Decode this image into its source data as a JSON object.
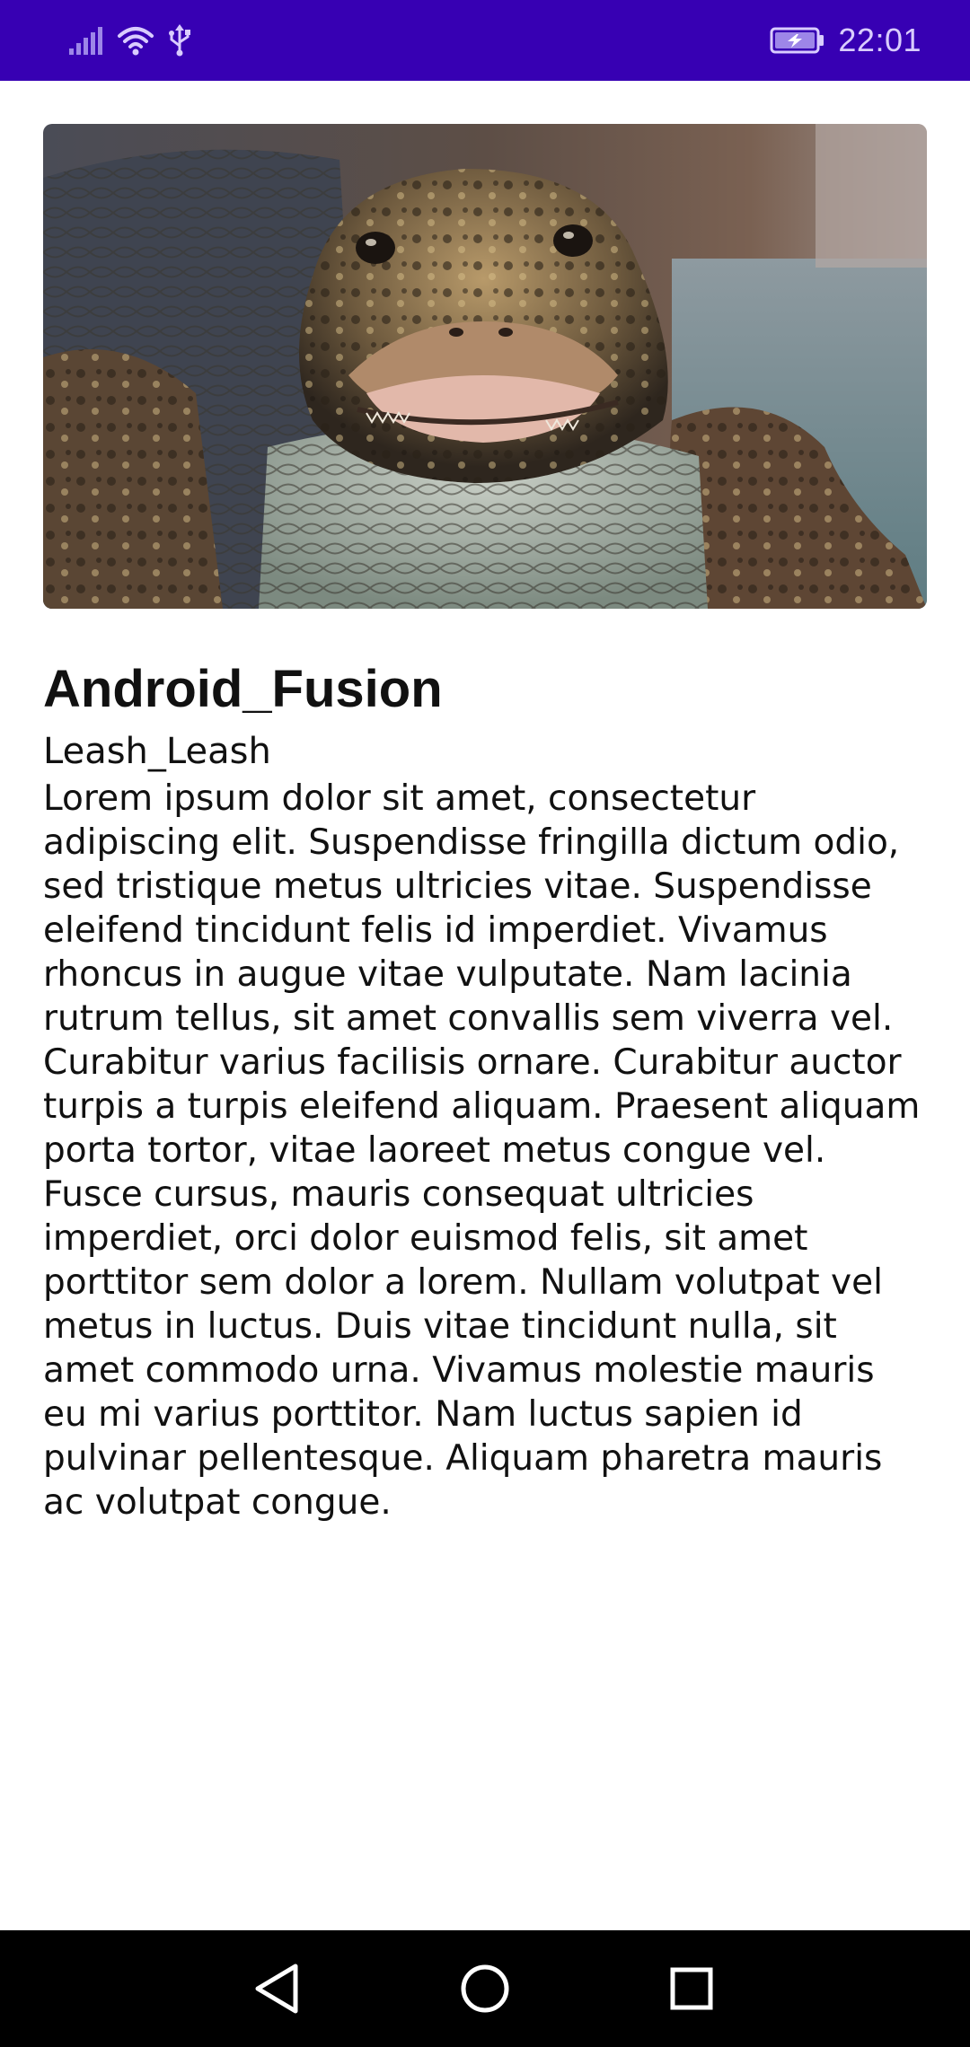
{
  "status_bar": {
    "time": "22:01",
    "icons": [
      "signal-icon",
      "wifi-icon",
      "usb-icon",
      "battery-charging-icon"
    ]
  },
  "article": {
    "image_alt": "Close-up photo of a crocodilian facing the camera",
    "title": "Android_Fusion",
    "subtitle": "Leash_Leash",
    "body": "Lorem ipsum dolor sit amet, consectetur adipiscing elit. Suspendisse fringilla dictum odio, sed tristique metus ultricies vitae. Suspendisse eleifend tincidunt felis id imperdiet. Vivamus rhoncus in augue vitae vulputate. Nam lacinia rutrum tellus, sit amet convallis sem viverra vel. Curabitur varius facilisis ornare. Curabitur auctor turpis a turpis eleifend aliquam. Praesent aliquam porta tortor, vitae laoreet metus congue vel. Fusce cursus, mauris consequat ultricies imperdiet, orci dolor euismod felis, sit amet porttitor sem dolor a lorem. Nullam volutpat vel metus in luctus. Duis vitae tincidunt nulla, sit amet commodo urna. Vivamus molestie mauris eu mi varius porttitor. Nam luctus sapien id pulvinar pellentesque. Aliquam pharetra mauris ac volutpat congue."
  },
  "nav_bar": {
    "buttons": [
      "back-icon",
      "home-icon",
      "recents-icon"
    ]
  },
  "colors": {
    "status_bar": "#3700b3",
    "nav_bar": "#000000",
    "text": "#111111",
    "background": "#ffffff"
  }
}
